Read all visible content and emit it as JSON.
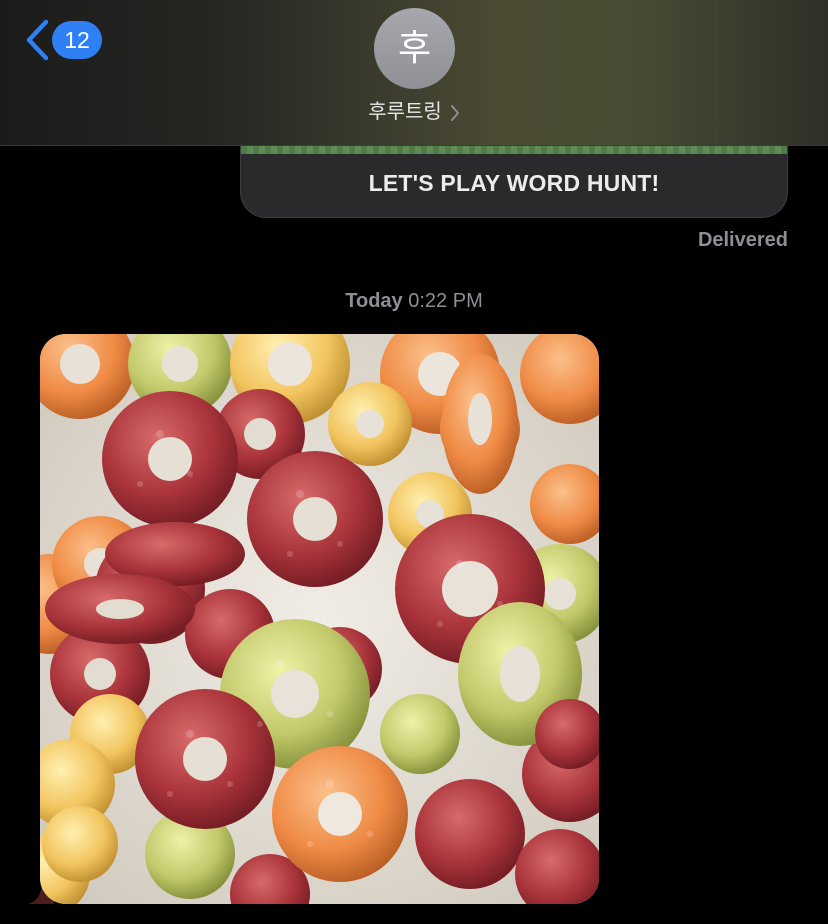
{
  "header": {
    "back_badge_count": "12",
    "avatar_initial": "후",
    "contact_name": "후루트링"
  },
  "thread": {
    "invite_card": {
      "title": "LET'S PLAY WORD HUNT!"
    },
    "delivered_label": "Delivered",
    "timestamp": {
      "day": "Today",
      "time": "0:22 PM"
    },
    "photo": {
      "subject": "colorful ring cereal in milk"
    }
  },
  "colors": {
    "accent_blue": "#2f7ff5",
    "bubble_dark": "#2a2a2c",
    "secondary_text": "#8e8e93",
    "milk": "#e9e4dc"
  },
  "icons": {
    "back": "chevron-left-icon",
    "contact_details": "chevron-right-icon"
  }
}
